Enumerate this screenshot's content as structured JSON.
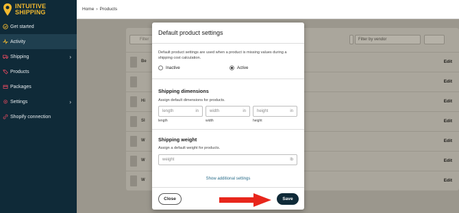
{
  "app": {
    "logo_line1": "INTUITIVE",
    "logo_line2": "SHIPPING",
    "brand_color": "#f2b92f"
  },
  "sidebar": {
    "items": [
      {
        "label": "Get started",
        "icon": "check-circle-icon"
      },
      {
        "label": "Activity",
        "icon": "activity-icon"
      },
      {
        "label": "Shipping",
        "icon": "truck-icon"
      },
      {
        "label": "Products",
        "icon": "tag-icon"
      },
      {
        "label": "Packages",
        "icon": "box-icon"
      },
      {
        "label": "Settings",
        "icon": "gear-icon"
      },
      {
        "label": "Shopify connection",
        "icon": "link-icon"
      }
    ]
  },
  "breadcrumb": {
    "home": "Home",
    "separator": "›",
    "current": "Products"
  },
  "background": {
    "search_placeholder": "Filter",
    "vendor_filter": "Filter by vendor",
    "rows": [
      {
        "name": "Be",
        "edit": "Edit"
      },
      {
        "name": "",
        "edit": "Edit"
      },
      {
        "name": "Hi",
        "edit": "Edit"
      },
      {
        "name": "Sl",
        "edit": "Edit"
      },
      {
        "name": "W",
        "edit": "Edit"
      },
      {
        "name": "W",
        "edit": "Edit"
      },
      {
        "name": "W",
        "edit": "Edit"
      }
    ]
  },
  "modal": {
    "title": "Default product settings",
    "description": "Default product settings are used when a product is missing values during a shipping cost calculation.",
    "radio_inactive": "Inactive",
    "radio_active": "Active",
    "dimensions": {
      "title": "Shipping dimensions",
      "subtitle": "Assign default dimensions for products.",
      "length_placeholder": "length",
      "width_placeholder": "width",
      "height_placeholder": "height",
      "unit": "in",
      "length_label": "length",
      "width_label": "width",
      "height_label": "height"
    },
    "weight": {
      "title": "Shipping weight",
      "subtitle": "Assign a default weight for products.",
      "placeholder": "weight",
      "unit": "lb"
    },
    "additional_link": "Show additional settings",
    "close_label": "Close",
    "save_label": "Save"
  },
  "colors": {
    "sidebar": "#0f2a38",
    "accent_link": "#2a6d8a",
    "annotation_arrow": "#e8261c"
  }
}
